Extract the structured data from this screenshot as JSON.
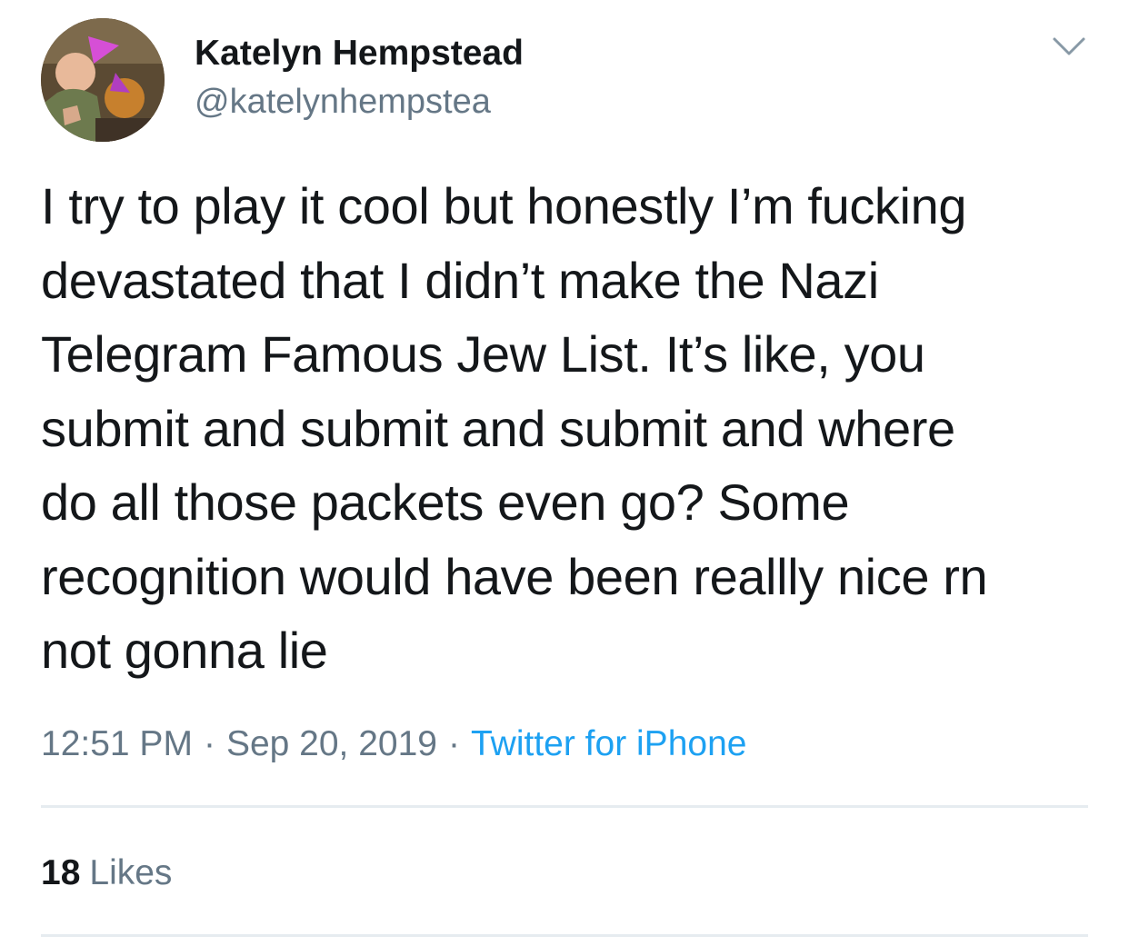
{
  "tweet": {
    "author": {
      "display_name": "Katelyn Hempstead",
      "handle": "@katelynhempstea",
      "avatar_icon": "profile-photo-party-hats"
    },
    "menu_icon": "chevron-down-icon",
    "text": "I try to play it cool but honestly I’m fucking\ndevastated that I didn’t make the Nazi\nTelegram Famous Jew List. It’s like, you\nsubmit and submit and submit and where\ndo all those packets even go? Some\nrecognition would have been reallly nice rn\nnot gonna lie",
    "time": "12:51 PM",
    "separator": "·",
    "date": "Sep 20, 2019",
    "source": "Twitter for iPhone",
    "likes_count": "18",
    "likes_label": "Likes"
  },
  "colors": {
    "text_primary": "#14171a",
    "text_secondary": "#657786",
    "link": "#1da1f2",
    "divider": "#e6ecf0",
    "background": "#ffffff"
  }
}
